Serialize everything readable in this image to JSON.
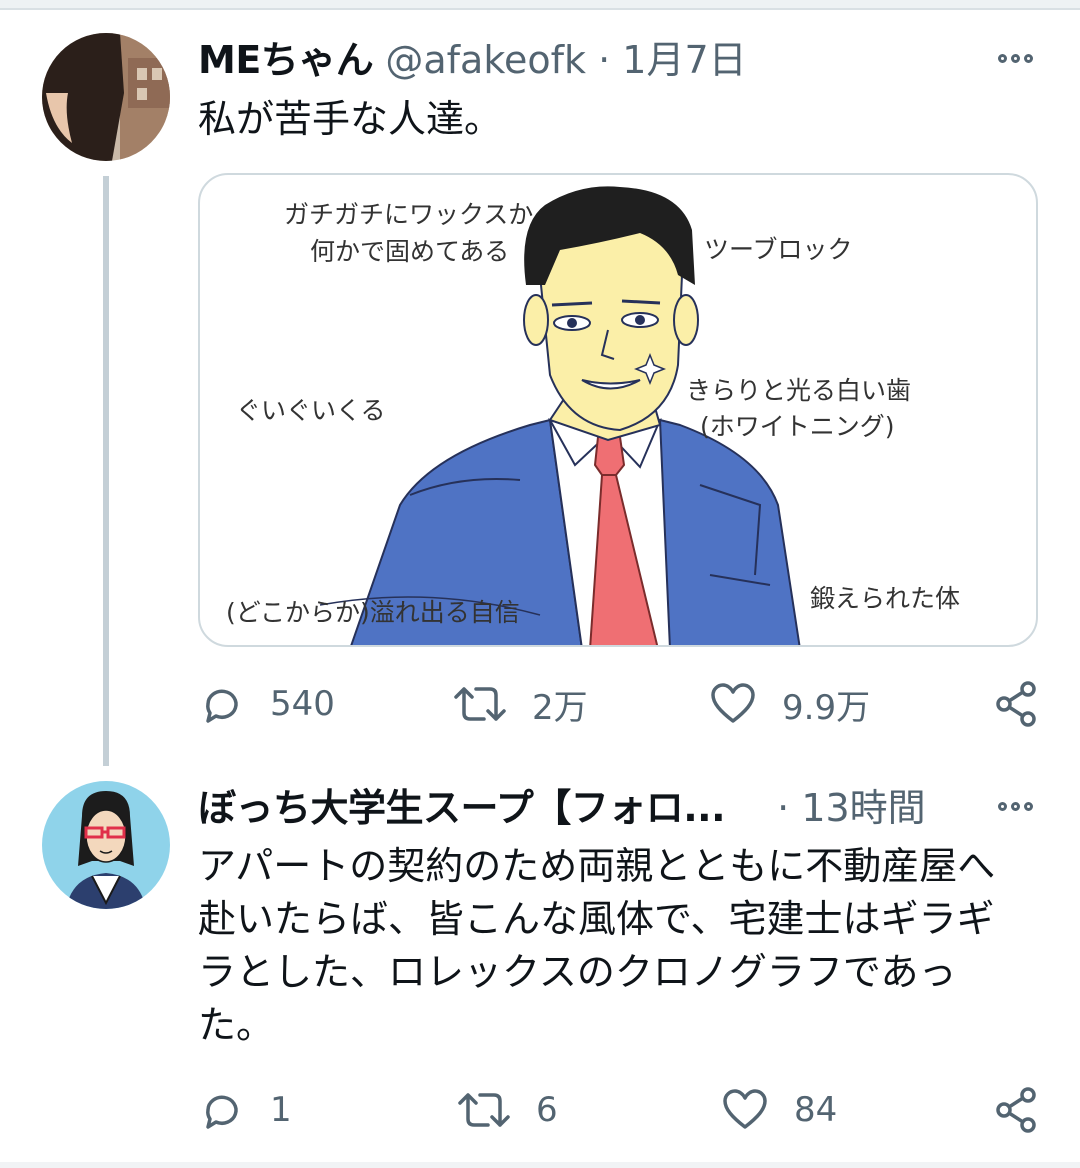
{
  "tweets": [
    {
      "display_name": "MEちゃん",
      "handle": "@afakeofk",
      "separator": "·",
      "time": "1月7日",
      "text": "私が苦手な人達。",
      "image_labels": {
        "label1": "ガチガチにワックスか",
        "label2": "何かで固めてある",
        "label3": "ツーブロック",
        "label4": "ぐいぐいくる",
        "label5": "きらりと光る白い歯",
        "label6": "(ホワイトニング)",
        "label7": "(どこからか)溢れ出る自信",
        "label8": "鍛えられた体"
      },
      "replies": "540",
      "retweets": "2万",
      "likes": "9.9万"
    },
    {
      "display_name": "ぼっち大学生スープ【フォロ...",
      "separator": "·",
      "time": "13時間",
      "text_lines": [
        "アパートの契約のため両親とともに不動産屋へ",
        "赴いたらば、皆こんな風体で、宅建士はギラギ",
        "ラとした、ロレックスのクロノグラフであっ",
        "た。"
      ],
      "replies": "1",
      "retweets": "6",
      "likes": "84"
    }
  ],
  "icons": {
    "reply": "reply-icon",
    "retweet": "retweet-icon",
    "like": "heart-icon",
    "share": "share-icon",
    "more": "more-icon"
  },
  "colors": {
    "text": "#0f1419",
    "muted": "#536471",
    "thread_line": "#c4cfd6",
    "border": "#cfd9de",
    "suit_blue": "#4f73c4",
    "tie_red": "#ef6f73",
    "skin": "#fbefa8"
  }
}
